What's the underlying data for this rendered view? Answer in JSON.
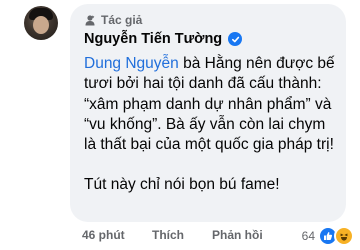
{
  "badge": {
    "label": "Tác giả",
    "icon": "author-badge-icon"
  },
  "author": {
    "name": "Nguyễn Tiến Tường",
    "verified": true
  },
  "comment": {
    "mention": "Dung Nguyễn",
    "body_after_mention": " bà Hằng nên được bế tươi bởi hai tội danh đã cấu thành: “xâm phạm danh dự nhân phẩm” và “vu khống”. Bà ấy vẫn còn lai chym là thất bại của một quốc gia pháp trị!",
    "second_paragraph": "Tút này chỉ nói bọn bú fame!"
  },
  "footer": {
    "time": "46 phút",
    "like_label": "Thích",
    "reply_label": "Phản hồi"
  },
  "reactions": {
    "count": "64",
    "types": [
      "like-icon",
      "haha-icon"
    ]
  },
  "colors": {
    "bubble": "#f0f2f5",
    "mention": "#216fdb",
    "verified": "#1877f2",
    "muted": "#65676b"
  }
}
